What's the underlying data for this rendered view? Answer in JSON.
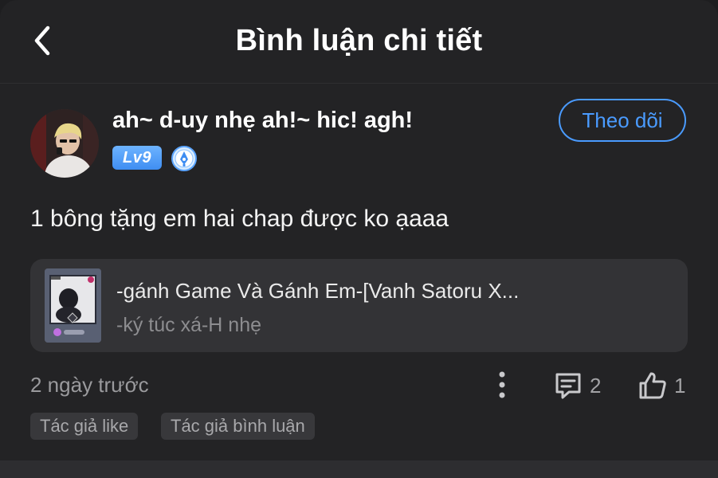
{
  "header": {
    "title": "Bình luận chi tiết",
    "back_icon": "chevron-left-icon"
  },
  "comment": {
    "author": {
      "name": "ah~ d-uy nhẹ ah!~ hic! agh!",
      "level": "Lv9",
      "medal_icon": "pen-medal-icon"
    },
    "follow_label": "Theo dõi",
    "text": "1 bông tặng em hai chap được ko ạaaa",
    "story": {
      "title": "-gánh Game Và Gánh Em-[Vanh Satoru X...",
      "subtitle": "-ký túc xá-H nhẹ"
    },
    "timestamp": "2 ngày trước",
    "reply_count": "2",
    "like_count": "1",
    "tags": [
      "Tác giả like",
      "Tác giả bình luận"
    ]
  },
  "colors": {
    "background": "#232325",
    "accent": "#4a9bff",
    "card": "#333336",
    "muted_text": "#9a9a9d"
  }
}
